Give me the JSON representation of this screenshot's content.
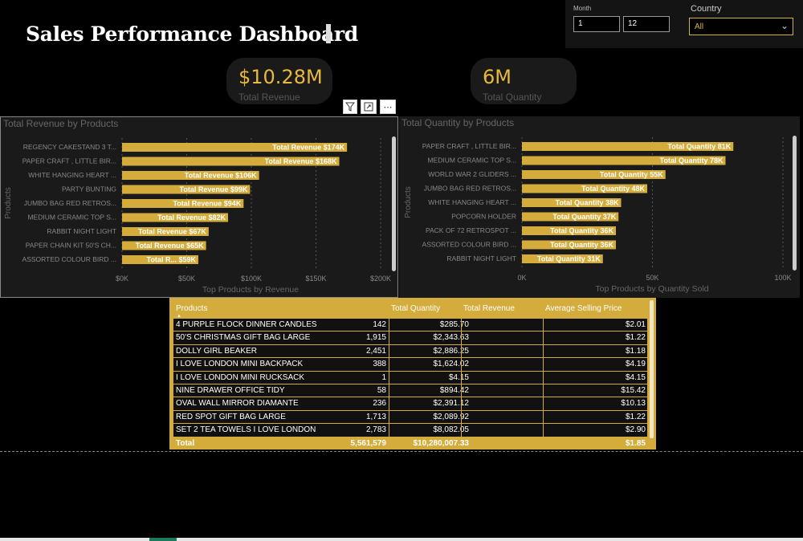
{
  "title": "Sales Performance Dashboard",
  "filters": {
    "month_label": "Month",
    "month_from": "1",
    "month_to": "12",
    "country_label": "Country",
    "country_value": "All"
  },
  "kpis": {
    "revenue_value": "$10.28M",
    "revenue_label": "Total Revenue",
    "quantity_value": "6M",
    "quantity_label": "Total Quantity"
  },
  "colors": {
    "accent": "#d4ac3c",
    "background": "#000000",
    "panel": "#1a1a1a",
    "kpi_value": "#e8b93b"
  },
  "icons": [
    "filter-icon",
    "focus-mode-icon",
    "more-options-icon",
    "chevron-down-icon"
  ],
  "chart_data": [
    {
      "type": "bar",
      "orientation": "horizontal",
      "title": "Total Revenue by Products",
      "xlabel": "Top Products by Revenue",
      "ylabel": "Products",
      "categories": [
        "REGENCY CAKESTAND 3 T...",
        "PAPER CRAFT , LITTLE BIR...",
        "WHITE HANGING HEART ...",
        "PARTY BUNTING",
        "JUMBO BAG RED RETROS...",
        "MEDIUM CERAMIC TOP S...",
        "RABBIT NIGHT LIGHT",
        "PAPER CHAIN KIT 50'S CH...",
        "ASSORTED COLOUR BIRD ..."
      ],
      "values": [
        174,
        168,
        106,
        99,
        94,
        82,
        67,
        65,
        59
      ],
      "data_labels": [
        "Total Revenue $174K",
        "Total Revenue $168K",
        "Total Revenue $106K",
        "Total Revenue $99K",
        "Total Revenue $94K",
        "Total Revenue $82K",
        "Total Revenue $67K",
        "Total Revenue $65K",
        "Total R... $59K"
      ],
      "xticks": [
        "$0K",
        "$50K",
        "$100K",
        "$150K",
        "$200K"
      ],
      "xlim": [
        0,
        200
      ],
      "grid": true
    },
    {
      "type": "bar",
      "orientation": "horizontal",
      "title": "Total Quantity by Products",
      "xlabel": "Top Products by Quantity Sold",
      "ylabel": "Products",
      "categories": [
        "PAPER CRAFT , LITTLE BIR...",
        "MEDIUM CERAMIC TOP S...",
        "WORLD WAR 2 GLIDERS ...",
        "JUMBO BAG RED RETROS...",
        "WHITE HANGING HEART ...",
        "POPCORN HOLDER",
        "PACK OF 72 RETROSPOT ...",
        "ASSORTED COLOUR BIRD ...",
        "RABBIT NIGHT LIGHT"
      ],
      "values": [
        81,
        78,
        55,
        48,
        38,
        37,
        36,
        36,
        31
      ],
      "data_labels": [
        "Total Quantity 81K",
        "Total Quantity 78K",
        "Total Quantity 55K",
        "Total Quantity 48K",
        "Total Quantity 38K",
        "Total Quantity 37K",
        "Total Quantity 36K",
        "Total Quantity 36K",
        "Total Quantity 31K"
      ],
      "xticks": [
        "0K",
        "50K",
        "100K"
      ],
      "xlim": [
        0,
        100
      ],
      "grid": true
    }
  ],
  "table": {
    "headers": [
      "Products",
      "Total Quantity",
      "Total Revenue",
      "Average Selling Price"
    ],
    "rows": [
      [
        "4 PURPLE FLOCK DINNER CANDLES",
        "142",
        "$285.70",
        "$2.01"
      ],
      [
        "50'S CHRISTMAS GIFT BAG LARGE",
        "1,915",
        "$2,343.63",
        "$1.22"
      ],
      [
        "DOLLY GIRL BEAKER",
        "2,451",
        "$2,886.25",
        "$1.18"
      ],
      [
        "I LOVE LONDON MINI BACKPACK",
        "388",
        "$1,624.02",
        "$4.19"
      ],
      [
        "I LOVE LONDON MINI RUCKSACK",
        "1",
        "$4.15",
        "$4.15"
      ],
      [
        "NINE DRAWER OFFICE TIDY",
        "58",
        "$894.42",
        "$15.42"
      ],
      [
        "OVAL WALL MIRROR DIAMANTE",
        "236",
        "$2,391.12",
        "$10.13"
      ],
      [
        "RED SPOT GIFT BAG LARGE",
        "1,713",
        "$2,089.92",
        "$1.22"
      ],
      [
        "SET 2 TEA TOWELS I LOVE LONDON",
        "2,783",
        "$8,082.05",
        "$2.90"
      ]
    ],
    "total": [
      "Total",
      "5,561,579",
      "$10,280,007.33",
      "$1.85"
    ]
  }
}
